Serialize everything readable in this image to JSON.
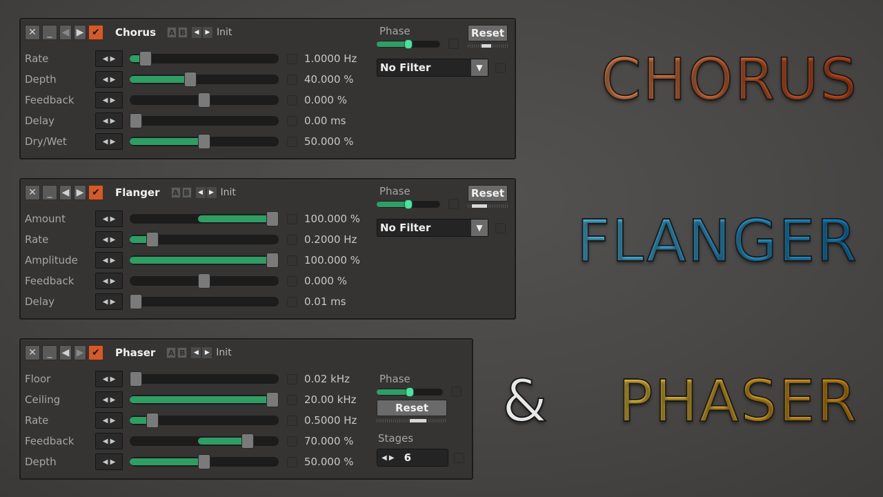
{
  "headings": {
    "chorus": {
      "text": "CHORUS",
      "color_start": "#ff9a5e",
      "color_end": "#d9501e"
    },
    "flanger": {
      "text": "FLANGER",
      "color_start": "#5cd4ff",
      "color_end": "#1a8fd6"
    },
    "amp": {
      "text": "&",
      "color": "#e8e8e8"
    },
    "phaser": {
      "text": "PHASER",
      "color_start": "#ffd84a",
      "color_end": "#e89a1a"
    }
  },
  "accent_colors": {
    "enabled_check": "#d35a2a",
    "slider_fill": "#2f9e64",
    "phase_knob": "#4fe0a0"
  },
  "icons": {
    "close": "✕",
    "minimize": "_",
    "left": "◀",
    "right": "▶",
    "check": "✔",
    "dropdown": "▼",
    "a": "A",
    "b": "B"
  },
  "plugins": [
    {
      "name": "Chorus",
      "preset": "Init",
      "params": [
        {
          "label": "Rate",
          "value": "1.0000 Hz",
          "fill_from": 0.0,
          "fill_to": 0.07
        },
        {
          "label": "Depth",
          "value": "40.000 %",
          "fill_from": 0.0,
          "fill_to": 0.4
        },
        {
          "label": "Feedback",
          "value": "0.000 %",
          "fill_from": 0.5,
          "fill_to": 0.5
        },
        {
          "label": "Delay",
          "value": "0.00 ms",
          "fill_from": 0.0,
          "fill_to": 0.0
        },
        {
          "label": "Dry/Wet",
          "value": "50.000 %",
          "fill_from": 0.0,
          "fill_to": 0.5
        }
      ],
      "phase": {
        "label": "Phase",
        "level": 0.5,
        "reset": "Reset"
      },
      "filter": "No Filter"
    },
    {
      "name": "Flanger",
      "preset": "Init",
      "params": [
        {
          "label": "Amount",
          "value": "100.000 %",
          "fill_from": 0.5,
          "fill_to": 1.0
        },
        {
          "label": "Rate",
          "value": "0.2000 Hz",
          "fill_from": 0.0,
          "fill_to": 0.12
        },
        {
          "label": "Amplitude",
          "value": "100.000 %",
          "fill_from": 0.0,
          "fill_to": 1.0
        },
        {
          "label": "Feedback",
          "value": "0.000 %",
          "fill_from": 0.5,
          "fill_to": 0.5
        },
        {
          "label": "Delay",
          "value": "0.01 ms",
          "fill_from": 0.0,
          "fill_to": 0.0
        }
      ],
      "phase": {
        "label": "Phase",
        "level": 0.5,
        "reset": "Reset"
      },
      "filter": "No Filter"
    },
    {
      "name": "Phaser",
      "preset": "Init",
      "params": [
        {
          "label": "Floor",
          "value": "0.02 kHz",
          "fill_from": 0.0,
          "fill_to": 0.0
        },
        {
          "label": "Ceiling",
          "value": "20.00 kHz",
          "fill_from": 0.0,
          "fill_to": 1.0
        },
        {
          "label": "Rate",
          "value": "0.5000 Hz",
          "fill_from": 0.0,
          "fill_to": 0.12
        },
        {
          "label": "Feedback",
          "value": "70.000 %",
          "fill_from": 0.5,
          "fill_to": 0.82
        },
        {
          "label": "Depth",
          "value": "50.000 %",
          "fill_from": 0.0,
          "fill_to": 0.5
        }
      ],
      "phase": {
        "label": "Phase",
        "level": 0.5,
        "reset": "Reset"
      },
      "stages": {
        "label": "Stages",
        "value": "6"
      }
    }
  ]
}
